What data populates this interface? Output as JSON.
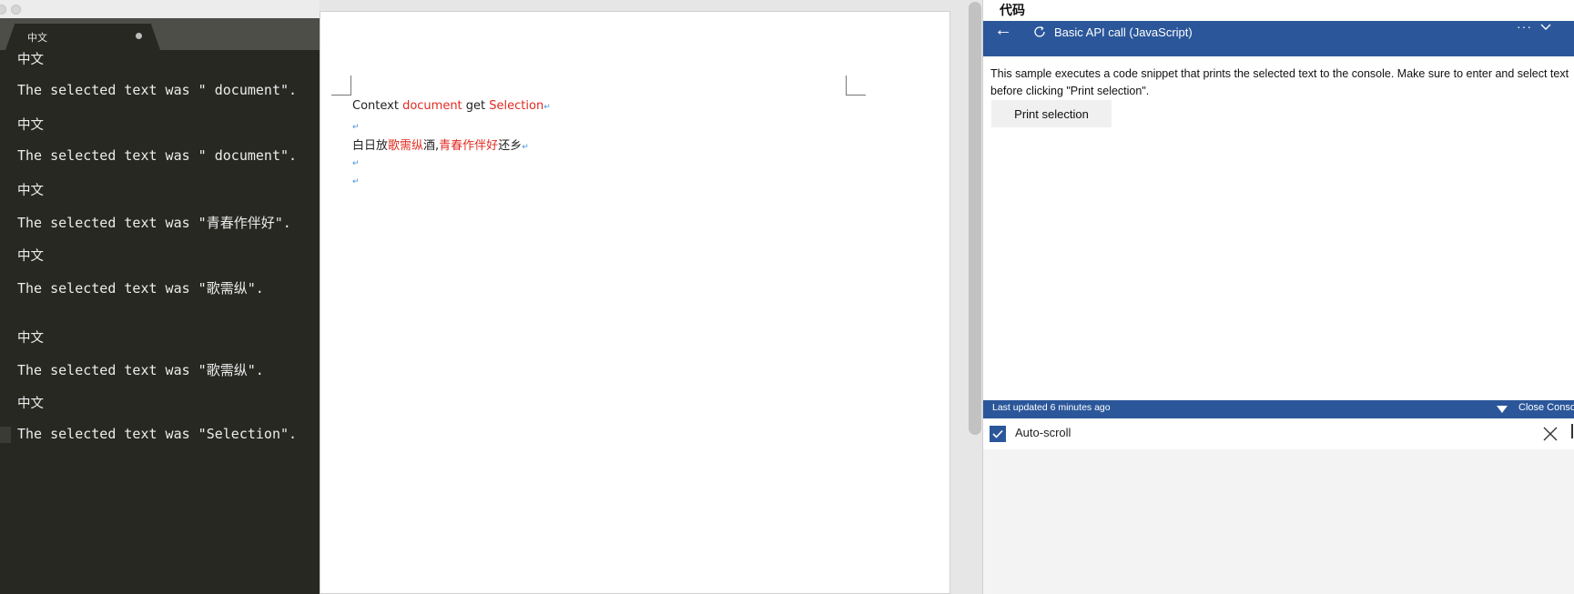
{
  "editor": {
    "tab_label": "中文",
    "lines": [
      {
        "head": "中文",
        "msg": "The selected text was \" document\"."
      },
      {
        "head": "中文",
        "msg": "The selected text was \" document\"."
      },
      {
        "head": "中文",
        "msg": "The selected text was \"青春作伴好\"."
      },
      {
        "head": "中文",
        "msg": "The selected text was \"歌需纵\"."
      },
      {
        "head": "中文",
        "msg": "The selected text was \"歌需纵\"."
      },
      {
        "head": "中文",
        "msg": "The selected text was \"Selection\"."
      }
    ]
  },
  "document": {
    "line1": {
      "w1": "Context ",
      "w2": "document",
      "w3": " get ",
      "w4": "Selection"
    },
    "line2": {
      "w1": "白日放",
      "w2": "歌需纵",
      "w3": "酒,",
      "w4": "青春作伴好",
      "w5": "还乡"
    },
    "para_mark": "↵"
  },
  "addin": {
    "pane_title": "代码",
    "header_title": "Basic API call (JavaScript)",
    "description": "This sample executes a code snippet that prints the selected text to the console. Make sure to enter and select text before clicking \"Print selection\".",
    "print_button": "Print selection",
    "last_updated": "Last updated 6 minutes ago",
    "close_console": "Close Console",
    "autoscroll": "Auto-scroll",
    "accent_color": "#2b579a"
  }
}
